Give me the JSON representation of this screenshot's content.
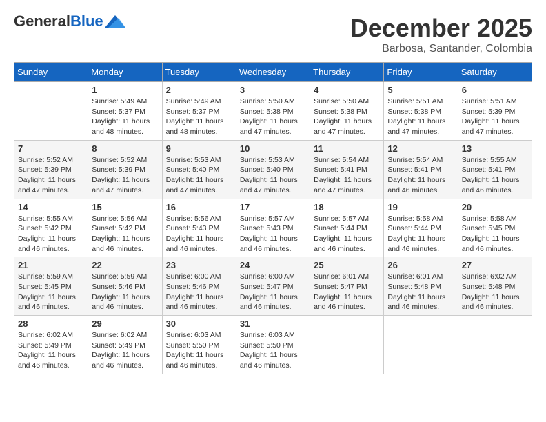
{
  "header": {
    "logo_general": "General",
    "logo_blue": "Blue",
    "month_title": "December 2025",
    "location": "Barbosa, Santander, Colombia"
  },
  "days_of_week": [
    "Sunday",
    "Monday",
    "Tuesday",
    "Wednesday",
    "Thursday",
    "Friday",
    "Saturday"
  ],
  "weeks": [
    [
      {
        "day": "",
        "info": ""
      },
      {
        "day": "1",
        "info": "Sunrise: 5:49 AM\nSunset: 5:37 PM\nDaylight: 11 hours\nand 48 minutes."
      },
      {
        "day": "2",
        "info": "Sunrise: 5:49 AM\nSunset: 5:37 PM\nDaylight: 11 hours\nand 48 minutes."
      },
      {
        "day": "3",
        "info": "Sunrise: 5:50 AM\nSunset: 5:38 PM\nDaylight: 11 hours\nand 47 minutes."
      },
      {
        "day": "4",
        "info": "Sunrise: 5:50 AM\nSunset: 5:38 PM\nDaylight: 11 hours\nand 47 minutes."
      },
      {
        "day": "5",
        "info": "Sunrise: 5:51 AM\nSunset: 5:38 PM\nDaylight: 11 hours\nand 47 minutes."
      },
      {
        "day": "6",
        "info": "Sunrise: 5:51 AM\nSunset: 5:39 PM\nDaylight: 11 hours\nand 47 minutes."
      }
    ],
    [
      {
        "day": "7",
        "info": "Sunrise: 5:52 AM\nSunset: 5:39 PM\nDaylight: 11 hours\nand 47 minutes."
      },
      {
        "day": "8",
        "info": "Sunrise: 5:52 AM\nSunset: 5:39 PM\nDaylight: 11 hours\nand 47 minutes."
      },
      {
        "day": "9",
        "info": "Sunrise: 5:53 AM\nSunset: 5:40 PM\nDaylight: 11 hours\nand 47 minutes."
      },
      {
        "day": "10",
        "info": "Sunrise: 5:53 AM\nSunset: 5:40 PM\nDaylight: 11 hours\nand 47 minutes."
      },
      {
        "day": "11",
        "info": "Sunrise: 5:54 AM\nSunset: 5:41 PM\nDaylight: 11 hours\nand 47 minutes."
      },
      {
        "day": "12",
        "info": "Sunrise: 5:54 AM\nSunset: 5:41 PM\nDaylight: 11 hours\nand 46 minutes."
      },
      {
        "day": "13",
        "info": "Sunrise: 5:55 AM\nSunset: 5:41 PM\nDaylight: 11 hours\nand 46 minutes."
      }
    ],
    [
      {
        "day": "14",
        "info": "Sunrise: 5:55 AM\nSunset: 5:42 PM\nDaylight: 11 hours\nand 46 minutes."
      },
      {
        "day": "15",
        "info": "Sunrise: 5:56 AM\nSunset: 5:42 PM\nDaylight: 11 hours\nand 46 minutes."
      },
      {
        "day": "16",
        "info": "Sunrise: 5:56 AM\nSunset: 5:43 PM\nDaylight: 11 hours\nand 46 minutes."
      },
      {
        "day": "17",
        "info": "Sunrise: 5:57 AM\nSunset: 5:43 PM\nDaylight: 11 hours\nand 46 minutes."
      },
      {
        "day": "18",
        "info": "Sunrise: 5:57 AM\nSunset: 5:44 PM\nDaylight: 11 hours\nand 46 minutes."
      },
      {
        "day": "19",
        "info": "Sunrise: 5:58 AM\nSunset: 5:44 PM\nDaylight: 11 hours\nand 46 minutes."
      },
      {
        "day": "20",
        "info": "Sunrise: 5:58 AM\nSunset: 5:45 PM\nDaylight: 11 hours\nand 46 minutes."
      }
    ],
    [
      {
        "day": "21",
        "info": "Sunrise: 5:59 AM\nSunset: 5:45 PM\nDaylight: 11 hours\nand 46 minutes."
      },
      {
        "day": "22",
        "info": "Sunrise: 5:59 AM\nSunset: 5:46 PM\nDaylight: 11 hours\nand 46 minutes."
      },
      {
        "day": "23",
        "info": "Sunrise: 6:00 AM\nSunset: 5:46 PM\nDaylight: 11 hours\nand 46 minutes."
      },
      {
        "day": "24",
        "info": "Sunrise: 6:00 AM\nSunset: 5:47 PM\nDaylight: 11 hours\nand 46 minutes."
      },
      {
        "day": "25",
        "info": "Sunrise: 6:01 AM\nSunset: 5:47 PM\nDaylight: 11 hours\nand 46 minutes."
      },
      {
        "day": "26",
        "info": "Sunrise: 6:01 AM\nSunset: 5:48 PM\nDaylight: 11 hours\nand 46 minutes."
      },
      {
        "day": "27",
        "info": "Sunrise: 6:02 AM\nSunset: 5:48 PM\nDaylight: 11 hours\nand 46 minutes."
      }
    ],
    [
      {
        "day": "28",
        "info": "Sunrise: 6:02 AM\nSunset: 5:49 PM\nDaylight: 11 hours\nand 46 minutes."
      },
      {
        "day": "29",
        "info": "Sunrise: 6:02 AM\nSunset: 5:49 PM\nDaylight: 11 hours\nand 46 minutes."
      },
      {
        "day": "30",
        "info": "Sunrise: 6:03 AM\nSunset: 5:50 PM\nDaylight: 11 hours\nand 46 minutes."
      },
      {
        "day": "31",
        "info": "Sunrise: 6:03 AM\nSunset: 5:50 PM\nDaylight: 11 hours\nand 46 minutes."
      },
      {
        "day": "",
        "info": ""
      },
      {
        "day": "",
        "info": ""
      },
      {
        "day": "",
        "info": ""
      }
    ]
  ]
}
